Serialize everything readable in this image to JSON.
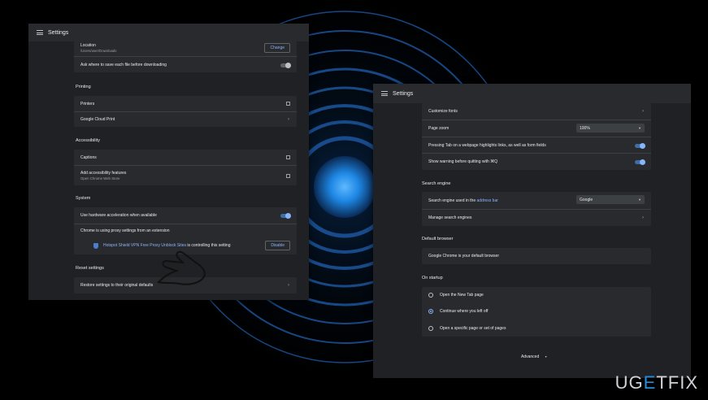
{
  "left_window": {
    "title": "Settings",
    "downloads": {
      "location_label": "Location",
      "location_path": "/Users/user/Downloads",
      "change_button": "Change",
      "ask_label": "Ask where to save each file before downloading"
    },
    "printing": {
      "heading": "Printing",
      "printers": "Printers",
      "cloud_print": "Google Cloud Print"
    },
    "accessibility": {
      "heading": "Accessibility",
      "captions": "Captions",
      "add_features": "Add accessibility features",
      "add_features_sub": "Open Chrome Web Store"
    },
    "system": {
      "heading": "System",
      "hw_accel": "Use hardware acceleration when available",
      "proxy": "Chrome is using proxy settings from an extension",
      "ext_name": "Hotspot Shield VPN Free Proxy",
      "ext_link": "Unblock Sites",
      "ext_suffix": " is controlling this setting",
      "disable_button": "Disable"
    },
    "reset": {
      "heading": "Reset settings",
      "restore": "Restore settings to their original defaults"
    }
  },
  "right_window": {
    "title": "Settings",
    "appearance": {
      "customize_fonts": "Customize fonts",
      "page_zoom": "Page zoom",
      "page_zoom_value": "100%",
      "tab_highlight": "Pressing Tab on a webpage highlights links, as well as form fields",
      "quit_warning": "Show warning before quitting with ⌘Q"
    },
    "search_engine": {
      "heading": "Search engine",
      "used_prefix": "Search engine used in the ",
      "address_bar_link": "address bar",
      "engine_value": "Google",
      "manage": "Manage search engines"
    },
    "default_browser": {
      "heading": "Default browser",
      "status": "Google Chrome is your default browser"
    },
    "on_startup": {
      "heading": "On startup",
      "options": [
        "Open the New Tab page",
        "Continue where you left off",
        "Open a specific page or set of pages"
      ],
      "selected_index": 1
    },
    "advanced": "Advanced"
  },
  "watermark": {
    "left": "UG",
    "mid": "E",
    "right": "TFIX"
  },
  "colors": {
    "accent": "#8ab4f8",
    "window_bg": "#202124",
    "card_bg": "#292a2d",
    "glow": "#1e88e5"
  }
}
